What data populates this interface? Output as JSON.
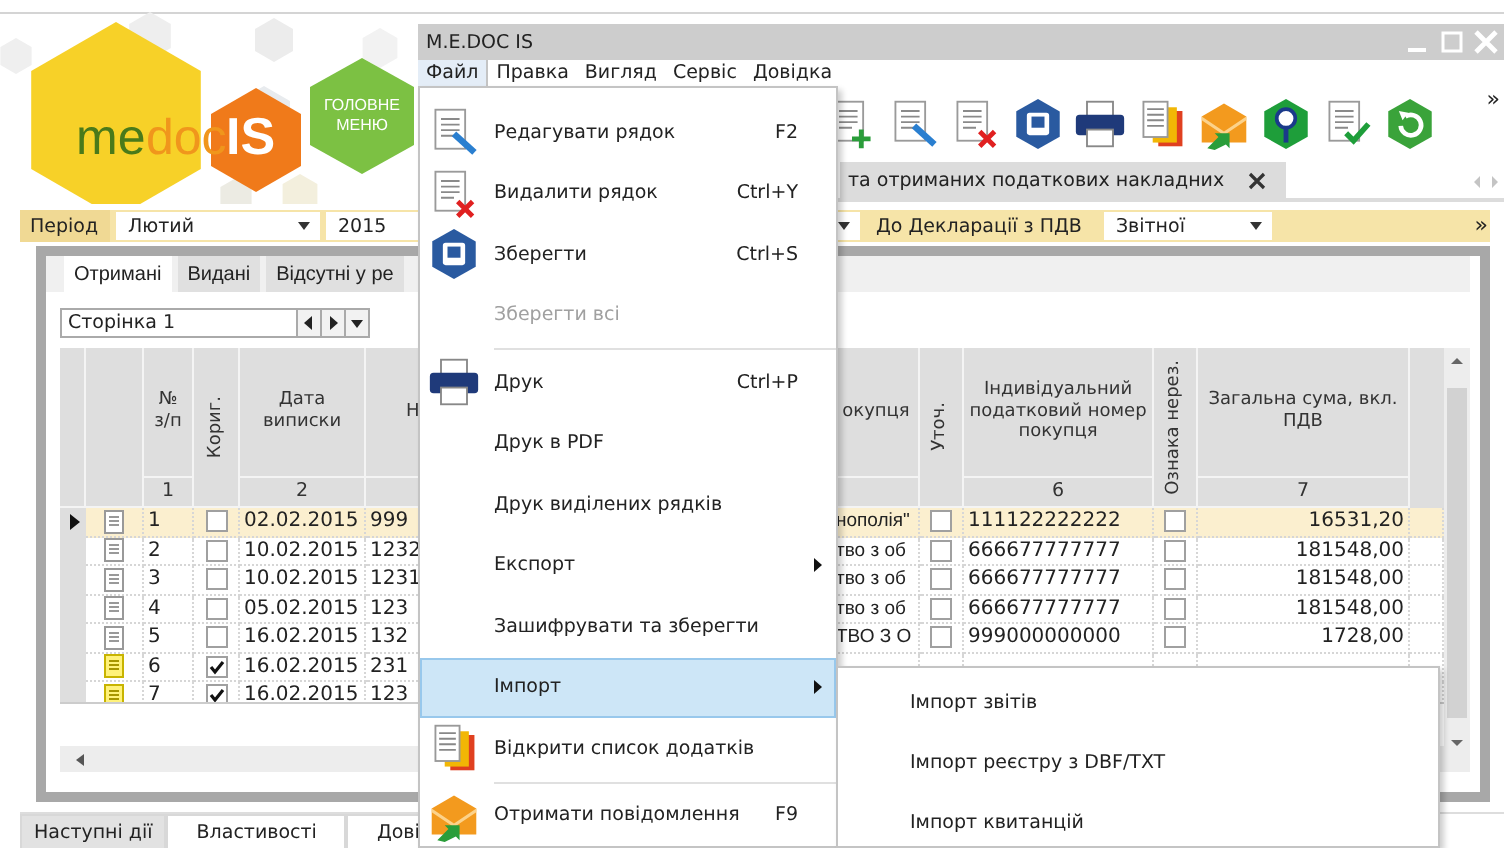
{
  "logo": {
    "me": "me",
    "doc": "doc",
    "is": "IS",
    "main_menu": "ГОЛОВНЕ МЕНЮ"
  },
  "window": {
    "title": "M.E.DOC IS"
  },
  "menu_bar": [
    {
      "label": "Файл",
      "selected": true
    },
    {
      "label": "Правка",
      "selected": false
    },
    {
      "label": "Вигляд",
      "selected": false
    },
    {
      "label": "Сервіс",
      "selected": false
    },
    {
      "label": "Довідка",
      "selected": false
    }
  ],
  "toolbar": {
    "overflow": "»"
  },
  "document_tab": {
    "label": "та отриманих податкових накладних"
  },
  "filter_bar": {
    "period_label": "Період",
    "month": "Лютий",
    "year": "2015",
    "declaration_label": "До Декларації з ПДВ",
    "declaration_type": "Звітної",
    "overflow": "»"
  },
  "tabs": [
    {
      "label": "Отримані",
      "selected": true
    },
    {
      "label": "Видані",
      "selected": false
    },
    {
      "label": "Відсутні у ре",
      "selected": false
    }
  ],
  "pager": {
    "value": "Сторінка 1"
  },
  "table": {
    "columns": [
      {
        "kind": "text",
        "label": "№ з/п",
        "number": "1"
      },
      {
        "kind": "check",
        "label": "Кориг."
      },
      {
        "kind": "text",
        "label": "Дата виписки",
        "number": "2"
      },
      {
        "kind": "text",
        "label": "Н"
      },
      {
        "kind": "text",
        "label": "окупця"
      },
      {
        "kind": "check",
        "label": "Уточ."
      },
      {
        "kind": "text",
        "label": "Індивідуальний податковий номер покупця",
        "number": "6"
      },
      {
        "kind": "check",
        "label": "Ознака нерез."
      },
      {
        "kind": "text",
        "label": "Загальна сума, вкл. ПДВ",
        "number": "7"
      }
    ],
    "rows": [
      {
        "selected": true,
        "cells": [
          {
            "text": "1"
          },
          {
            "checked": false
          },
          {
            "text": "02.02.2015"
          },
          {
            "text": "999"
          },
          {
            "text": "нополія\""
          },
          {
            "checked": false
          },
          {
            "text": "111122222222"
          },
          {
            "checked": false
          },
          {
            "text": "16531,20"
          }
        ]
      },
      {
        "selected": false,
        "cells": [
          {
            "text": "2"
          },
          {
            "checked": false
          },
          {
            "text": "10.02.2015"
          },
          {
            "text": "1232"
          },
          {
            "text": "тво з об"
          },
          {
            "checked": false
          },
          {
            "text": "666677777777"
          },
          {
            "checked": false
          },
          {
            "text": "181548,00"
          }
        ]
      },
      {
        "selected": false,
        "cells": [
          {
            "text": "3"
          },
          {
            "checked": false
          },
          {
            "text": "10.02.2015"
          },
          {
            "text": "1231"
          },
          {
            "text": "тво з об"
          },
          {
            "checked": false
          },
          {
            "text": "666677777777"
          },
          {
            "checked": false
          },
          {
            "text": "181548,00"
          }
        ]
      },
      {
        "selected": false,
        "cells": [
          {
            "text": "4"
          },
          {
            "checked": false
          },
          {
            "text": "05.02.2015"
          },
          {
            "text": "123"
          },
          {
            "text": "тво з об"
          },
          {
            "checked": false
          },
          {
            "text": "666677777777"
          },
          {
            "checked": false
          },
          {
            "text": "181548,00"
          }
        ]
      },
      {
        "selected": false,
        "cells": [
          {
            "text": "5"
          },
          {
            "checked": false
          },
          {
            "text": "16.02.2015"
          },
          {
            "text": "132"
          },
          {
            "text": "ТВО З О"
          },
          {
            "checked": false
          },
          {
            "text": "999000000000"
          },
          {
            "checked": false
          },
          {
            "text": "1728,00"
          }
        ]
      },
      {
        "selected": false,
        "cells": [
          {
            "text": "6"
          },
          {
            "checked": true
          },
          {
            "text": "16.02.2015"
          },
          {
            "text": "231"
          }
        ]
      },
      {
        "selected": false,
        "cells": [
          {
            "text": "7"
          },
          {
            "checked": true
          },
          {
            "text": "16.02.2015"
          },
          {
            "text": "123"
          }
        ]
      }
    ]
  },
  "file_menu": {
    "items": [
      {
        "kind": "item",
        "label": "Редагувати рядок",
        "shortcut": "F2",
        "disabled": false,
        "selected": false,
        "submenu": false
      },
      {
        "kind": "item",
        "label": "Видалити рядок",
        "shortcut": "Ctrl+Y",
        "disabled": false,
        "selected": false,
        "submenu": false
      },
      {
        "kind": "item",
        "label": "Зберегти",
        "shortcut": "Ctrl+S",
        "disabled": false,
        "selected": false,
        "submenu": false
      },
      {
        "kind": "item",
        "label": "Зберегти всі",
        "disabled": true,
        "selected": false,
        "submenu": false
      },
      {
        "kind": "separator"
      },
      {
        "kind": "item",
        "label": "Друк",
        "shortcut": "Ctrl+P",
        "disabled": false,
        "selected": false,
        "submenu": false
      },
      {
        "kind": "item",
        "label": "Друк в PDF",
        "disabled": false,
        "selected": false,
        "submenu": false
      },
      {
        "kind": "item",
        "label": "Друк виділених рядків",
        "disabled": false,
        "selected": false,
        "submenu": false
      },
      {
        "kind": "item",
        "label": "Експорт",
        "disabled": false,
        "selected": false,
        "submenu": true
      },
      {
        "kind": "item",
        "label": "Зашифрувати та зберегти",
        "disabled": false,
        "selected": false,
        "submenu": false
      },
      {
        "kind": "item",
        "label": "Імпорт",
        "disabled": false,
        "selected": true,
        "submenu": true
      },
      {
        "kind": "item",
        "label": "Відкрити список додатків",
        "disabled": false,
        "selected": false,
        "submenu": false
      },
      {
        "kind": "separator"
      },
      {
        "kind": "item",
        "label": "Отримати повідомлення",
        "shortcut": "F9",
        "disabled": false,
        "selected": false,
        "submenu": false
      }
    ]
  },
  "submenu": {
    "items": [
      {
        "label": "Імпорт звітів"
      },
      {
        "label": "Імпорт реєстру з DBF/TXT"
      },
      {
        "label": "Імпорт квитанцій"
      }
    ]
  },
  "bottom_tabs": [
    {
      "label": "Наступні дії",
      "selected": true
    },
    {
      "label": "Властивості",
      "selected": false
    },
    {
      "label": "Дові",
      "selected": false
    }
  ]
}
